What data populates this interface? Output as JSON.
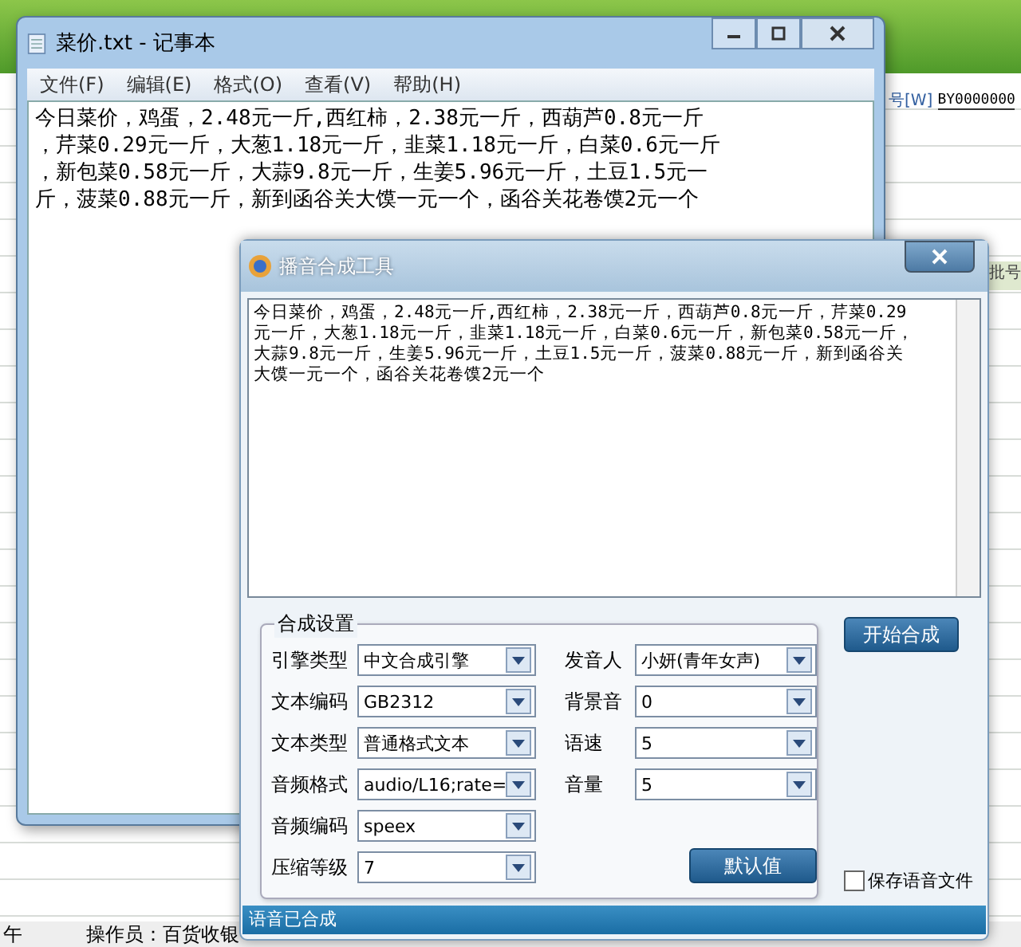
{
  "background_app": {
    "field_label": "号[W]",
    "field_value": "BY0000000",
    "column_header": "批号",
    "status_left": "午",
    "operator": "操作员：百货收银"
  },
  "notepad": {
    "title": "菜价.txt - 记事本",
    "menu": [
      "文件(F)",
      "编辑(E)",
      "格式(O)",
      "查看(V)",
      "帮助(H)"
    ],
    "lines": [
      "今日菜价，鸡蛋，2.48元一斤,西红柿，2.38元一斤，西葫芦0.8元一斤",
      "，芹菜0.29元一斤，大葱1.18元一斤，韭菜1.18元一斤，白菜0.6元一斤",
      "，新包菜0.58元一斤，大蒜9.8元一斤，生姜5.96元一斤，土豆1.5元一",
      "斤，菠菜0.88元一斤，新到函谷关大馍一元一个，函谷关花卷馍2元一个"
    ]
  },
  "dialog": {
    "title": "播音合成工具",
    "lines": [
      "今日菜价，鸡蛋，2.48元一斤,西红柿，2.38元一斤，西葫芦0.8元一斤，芹菜0.29",
      "元一斤，大葱1.18元一斤，韭菜1.18元一斤，白菜0.6元一斤，新包菜0.58元一斤，",
      "大蒜9.8元一斤，生姜5.96元一斤，土豆1.5元一斤，菠菜0.88元一斤，新到函谷关",
      "大馍一元一个，函谷关花卷馍2元一个"
    ],
    "group_title": "合成设置",
    "left_settings": [
      {
        "label": "引擎类型",
        "value": "中文合成引擎"
      },
      {
        "label": "文本编码",
        "value": "GB2312"
      },
      {
        "label": "文本类型",
        "value": "普通格式文本"
      },
      {
        "label": "音频格式",
        "value": "audio/L16;rate="
      },
      {
        "label": "音频编码",
        "value": "speex"
      },
      {
        "label": "压缩等级",
        "value": "7"
      }
    ],
    "right_settings": [
      {
        "label": "发音人",
        "value": "小妍(青年女声)"
      },
      {
        "label": "背景音",
        "value": "0"
      },
      {
        "label": "语速",
        "value": "5"
      },
      {
        "label": "音量",
        "value": "5"
      }
    ],
    "start_button": "开始合成",
    "default_button": "默认值",
    "save_checkbox": {
      "label": "保存语音文件",
      "checked": false
    },
    "status": "语音已合成"
  }
}
